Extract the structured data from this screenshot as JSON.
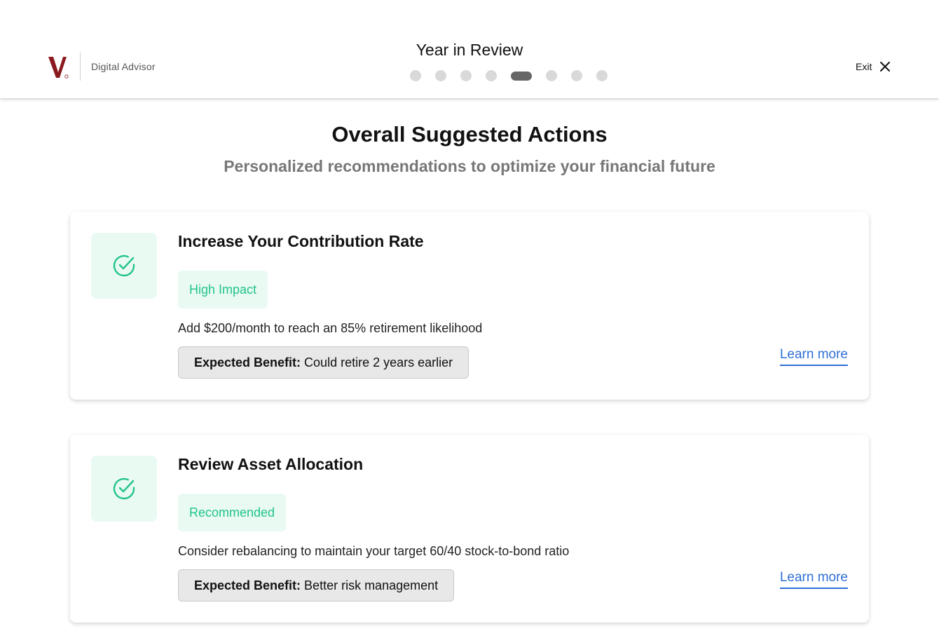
{
  "header": {
    "brand_label": "Digital Advisor",
    "title": "Year in Review",
    "progress": {
      "total_steps": 8,
      "current_step": 5
    },
    "exit_label": "Exit"
  },
  "page": {
    "title": "Overall Suggested Actions",
    "subtitle": "Personalized recommendations to optimize your financial future"
  },
  "colors": {
    "brand": "#8b1a1f",
    "accent_green": "#22c48a",
    "link_blue": "#2f6fd6"
  },
  "actions": [
    {
      "title": "Increase Your Contribution Rate",
      "badge": "High Impact",
      "description": "Add $200/month to reach an 85% retirement likelihood",
      "benefit_label": "Expected Benefit:",
      "benefit_value": "Could retire 2 years earlier",
      "link_label": "Learn more",
      "icon": "check-circle-icon"
    },
    {
      "title": "Review Asset Allocation",
      "badge": "Recommended",
      "description": "Consider rebalancing to maintain your target 60/40 stock-to-bond ratio",
      "benefit_label": "Expected Benefit:",
      "benefit_value": "Better risk management",
      "link_label": "Learn more",
      "icon": "check-circle-icon"
    }
  ]
}
